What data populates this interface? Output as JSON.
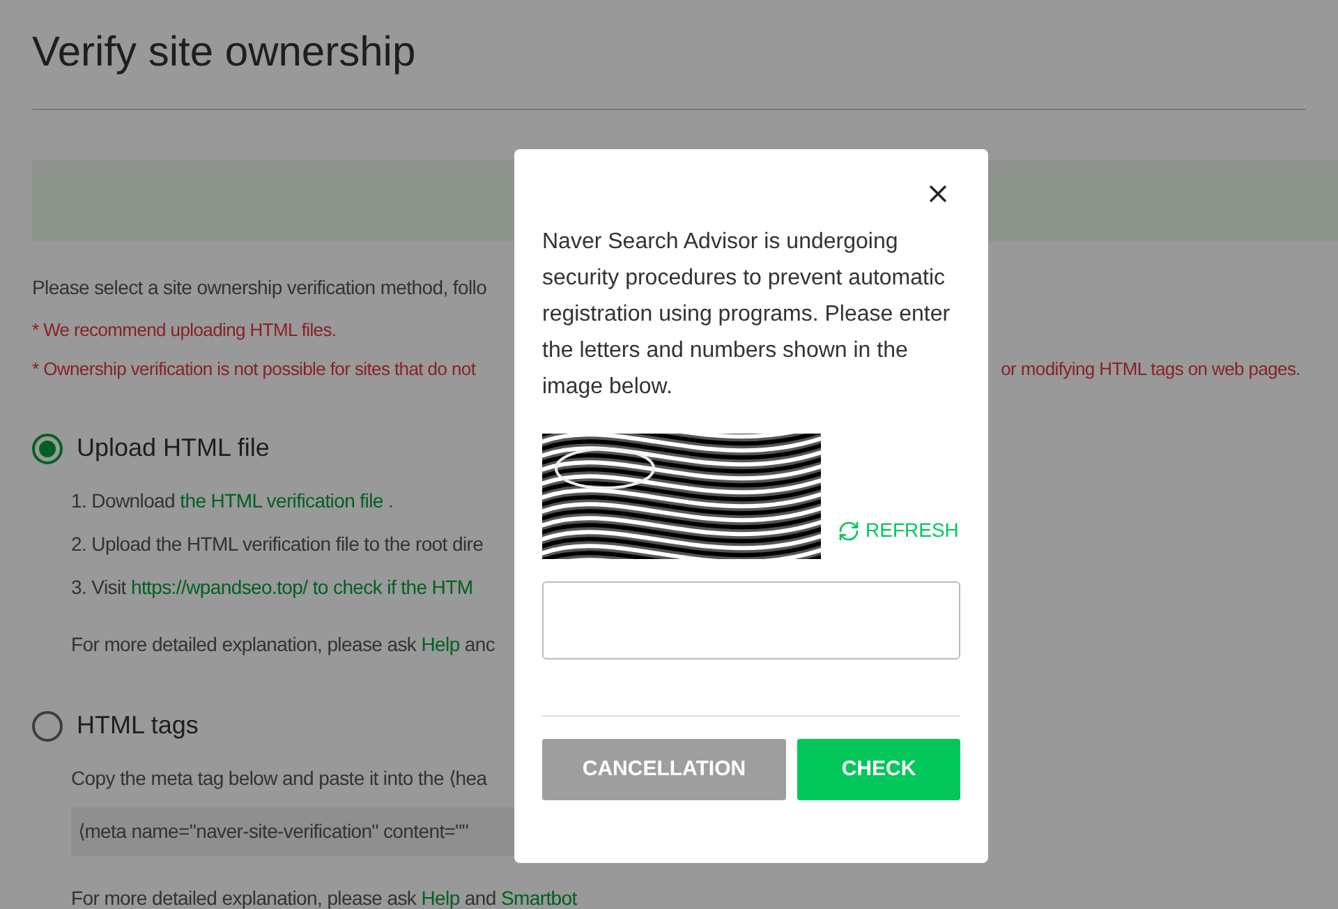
{
  "page": {
    "title": "Verify site ownership",
    "intro": "Please select a site ownership verification method, follo",
    "notes": [
      {
        "text": "* We recommend uploading HTML files."
      },
      {
        "text": "* Ownership verification is not possible for sites that do not",
        "continued": "or modifying HTML tags on web pages."
      }
    ],
    "methods": [
      {
        "label": "Upload HTML file",
        "selected": true,
        "lines": [
          [
            {
              "kind": "plain",
              "text": "1. Download "
            },
            {
              "kind": "link",
              "text": "the HTML verification file ."
            }
          ],
          [
            {
              "kind": "plain",
              "text": "2. Upload the HTML verification file to the root dire"
            }
          ],
          [
            {
              "kind": "plain",
              "text": "3. Visit "
            },
            {
              "kind": "link",
              "text": "https://wpandseo.top/ to check if the HTM"
            }
          ]
        ],
        "help": [
          {
            "kind": "plain",
            "text": "For more detailed explanation, please ask "
          },
          {
            "kind": "link",
            "text": "Help"
          },
          {
            "kind": "plain",
            "text": " anc"
          }
        ]
      },
      {
        "label": "HTML tags",
        "selected": false,
        "lines": [
          [
            {
              "kind": "plain",
              "text": "Copy the meta tag below and paste it into the ⟨hea"
            }
          ]
        ],
        "code": "⟨meta name=\"naver-site-verification\" content=\"\"",
        "help": [
          {
            "kind": "plain",
            "text": "For more detailed explanation, please ask "
          },
          {
            "kind": "link",
            "text": "Help"
          },
          {
            "kind": "plain",
            "text": " and "
          },
          {
            "kind": "link",
            "text": "Smartbot"
          }
        ]
      }
    ]
  },
  "dialog": {
    "message": "Naver Search Advisor is undergoing security procedures to prevent automatic registration using programs. Please enter the letters and numbers shown in the image below.",
    "refresh": "REFRESH",
    "buttons": [
      {
        "kind": "secondary",
        "label": "CANCELLATION"
      },
      {
        "kind": "primary",
        "label": "CHECK"
      }
    ]
  }
}
